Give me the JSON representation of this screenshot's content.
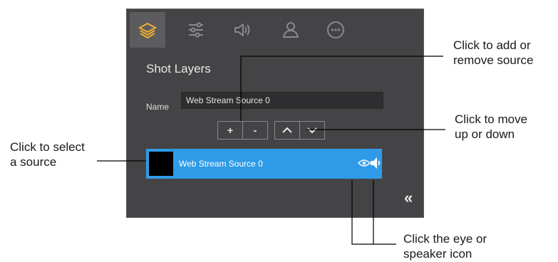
{
  "panel": {
    "tabs": [
      {
        "icon": "layers-icon",
        "active": true
      },
      {
        "icon": "sliders-icon",
        "active": false
      },
      {
        "icon": "speaker-icon",
        "active": false
      },
      {
        "icon": "person-icon",
        "active": false
      },
      {
        "icon": "more-icon",
        "active": false
      }
    ],
    "title": "Shot Layers",
    "name_label": "Name",
    "name_value": "Web Stream Source 0",
    "add_label": "+",
    "remove_label": "-",
    "up_icon": "chevron-up-icon",
    "down_icon": "chevron-down-icon",
    "source_row": {
      "label": "Web Stream Source 0",
      "selected": true
    },
    "collapse_label": "«"
  },
  "callouts": {
    "add_remove_line1": "Click to add or",
    "add_remove_line2": "remove source",
    "move_line1": "Click to move",
    "move_line2": "up or down",
    "select_line1": "Click to select",
    "select_line2": "a source",
    "eye_line1": "Click the eye or",
    "eye_line2": "speaker icon"
  },
  "colors": {
    "panel_bg": "#444446",
    "accent_icon": "#f0b030",
    "selection": "#2f9be8",
    "line": "#000000"
  }
}
